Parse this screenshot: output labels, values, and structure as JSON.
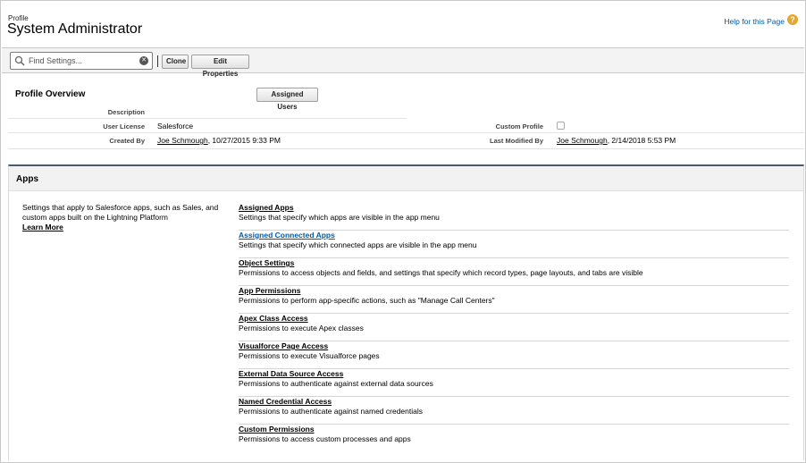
{
  "header": {
    "profile_label": "Profile",
    "title": "System Administrator",
    "help_link": "Help for this Page",
    "help_icon": "question-circle-icon"
  },
  "toolbar": {
    "search_placeholder": "Find Settings...",
    "clone_label": "Clone",
    "edit_label": "Edit Properties"
  },
  "overview": {
    "title": "Profile Overview",
    "assigned_users_label": "Assigned Users",
    "description_label": "Description",
    "user_license_label": "User License",
    "user_license_value": "Salesforce",
    "custom_profile_label": "Custom Profile",
    "custom_profile_checked": false,
    "created_by_label": "Created By",
    "created_by_name": "Joe Schmough",
    "created_by_date": ", 10/27/2015 9:33 PM",
    "last_modified_label": "Last Modified By",
    "last_modified_name": "Joe Schmough",
    "last_modified_date": ", 2/14/2018 5:53 PM"
  },
  "apps": {
    "title": "Apps",
    "description": "Settings that apply to Salesforce apps, such as Sales, and custom apps built on the Lightning Platform",
    "learn_more": "Learn More",
    "items": [
      {
        "title": "Assigned Apps",
        "desc": "Settings that specify which apps are visible in the app menu"
      },
      {
        "title": "Assigned Connected Apps",
        "desc": "Settings that specify which connected apps are visible in the app menu"
      },
      {
        "title": "Object Settings",
        "desc": "Permissions to access objects and fields, and settings that specify which record types, page layouts, and tabs are visible"
      },
      {
        "title": "App Permissions",
        "desc": "Permissions to perform app-specific actions, such as \"Manage Call Centers\""
      },
      {
        "title": "Apex Class Access",
        "desc": "Permissions to execute Apex classes"
      },
      {
        "title": "Visualforce Page Access",
        "desc": "Permissions to execute Visualforce pages"
      },
      {
        "title": "External Data Source Access",
        "desc": "Permissions to authenticate against external data sources"
      },
      {
        "title": "Named Credential Access",
        "desc": "Permissions to authenticate against named credentials"
      },
      {
        "title": "Custom Permissions",
        "desc": "Permissions to access custom processes and apps"
      }
    ]
  },
  "colors": {
    "link_active": "#015ba7",
    "section_border": "#4a5c6e",
    "help_icon": "#e5a72a"
  }
}
